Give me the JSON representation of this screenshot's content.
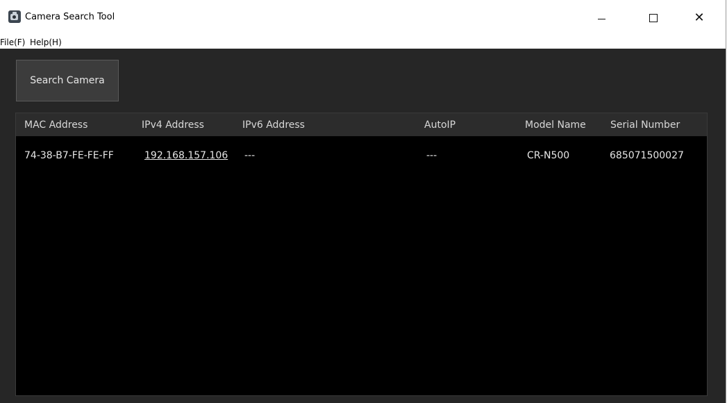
{
  "window": {
    "title": "Camera Search Tool",
    "icon": "camera-icon"
  },
  "menu": {
    "file": "File(F)",
    "help": "Help(H)"
  },
  "toolbar": {
    "search_label": "Search Camera"
  },
  "table": {
    "headers": [
      "MAC Address",
      "IPv4 Address",
      "IPv6 Address",
      "AutoIP",
      "Model Name",
      "Serial Number"
    ],
    "rows": [
      {
        "mac": "74-38-B7-FE-FE-FF",
        "ipv4": "192.168.157.106",
        "ipv6": "---",
        "autoip": "---",
        "model": "CR-N500",
        "serial": "685071500027"
      }
    ]
  },
  "colors": {
    "background": "#262626",
    "table_background": "#000000",
    "header_background": "#2c2c2c",
    "button_background": "#3c3c3c",
    "text": "#e6e6e6"
  }
}
